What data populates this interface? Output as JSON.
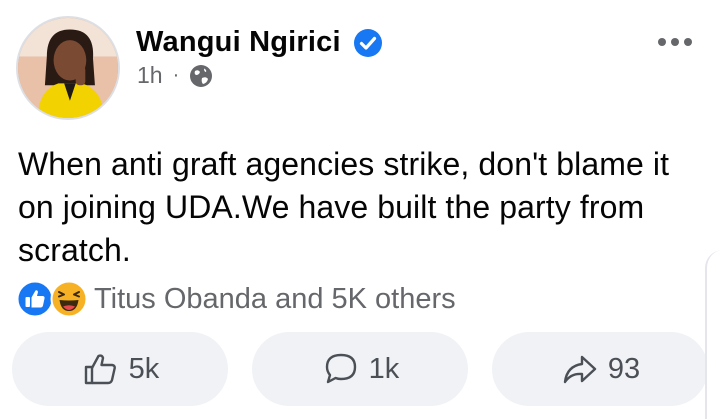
{
  "post": {
    "author": "Wangui Ngirici",
    "time": "1h",
    "separator": "·",
    "text": "When anti graft agencies strike, don't blame it on joining UDA.We have built the party from scratch.",
    "reactions_summary": "Titus Obanda and 5K others",
    "likes": "5k",
    "comments": "1k",
    "shares": "93"
  },
  "colors": {
    "verified": "#1877f2",
    "like": "#1877f2",
    "haha": "#f7b125",
    "muted_text": "#65676b",
    "button_bg": "#f0f2f5"
  },
  "icons": {
    "verified": "verified-badge-icon",
    "audience": "globe-icon",
    "menu": "more-horizontal-icon",
    "reaction_like": "like-reaction-icon",
    "reaction_haha": "haha-reaction-icon",
    "like_button": "thumbs-up-icon",
    "comment_button": "comment-bubble-icon",
    "share_button": "share-arrow-icon"
  }
}
